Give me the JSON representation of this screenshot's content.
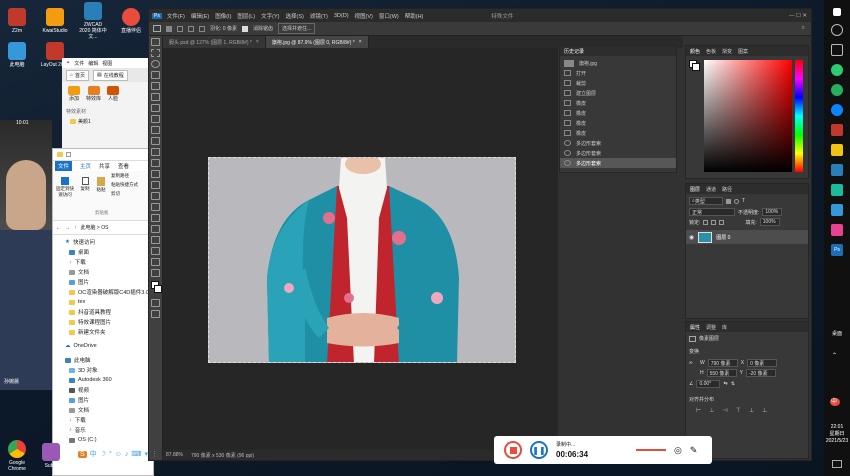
{
  "desktop": {
    "icons_row1": [
      "Z2m",
      "KwaiStudio",
      "ZWCAD 2020 简体中文...",
      "直播伴侣",
      "Effe"
    ],
    "icons_row2": [
      "此电脑",
      "LayOut 2017"
    ],
    "bottom_icons": [
      "Google Chrome",
      "Subst"
    ],
    "chat_label": "孙婉晨"
  },
  "side_app": {
    "title": "特效素材",
    "btn_home": "首页",
    "btn_online": "在线教程",
    "menu": [
      "文件",
      "编辑",
      "视图"
    ],
    "tools": [
      "添加",
      "特效库",
      "人脸"
    ],
    "tree_label": "美颜1",
    "time": "10:01"
  },
  "ps": {
    "menu": [
      "文件(F)",
      "编辑(E)",
      "图像(I)",
      "图层(L)",
      "文字(Y)",
      "选择(S)",
      "滤镜(T)",
      "3D(D)",
      "视图(V)",
      "窗口(W)",
      "帮助(H)"
    ],
    "window_title": "特殊文件",
    "options": {
      "feather_label": "羽化: 0 像素",
      "antialias": "消除锯齿",
      "select_mask": "选择并遮住..."
    },
    "tabs": [
      {
        "label": "服头.psd @ 127% (图层 1, RGB/8#) *"
      },
      {
        "label": "旗袍.jpg @ 87.9% (图层 0, RGB/8#) *"
      }
    ],
    "status": {
      "zoom": "87.88%",
      "dims": "790 像素 x 530 像素 (96 ppi)"
    },
    "history": {
      "title": "历史记录",
      "doc": "旗袍.jpg",
      "items": [
        "打开",
        "裁剪",
        "建立图层",
        "橡皮",
        "橡皮",
        "橡皮",
        "橡皮",
        "多边形套索",
        "多边形套索",
        "多边形套索"
      ],
      "selected_index": 9
    },
    "color_panel": {
      "tabs": [
        "颜色",
        "色板",
        "渐变",
        "图案"
      ]
    },
    "layers_panel": {
      "tabs": [
        "图层",
        "通道",
        "路径"
      ],
      "kind": "类型",
      "blend": "正常",
      "opacity_label": "不透明度:",
      "opacity": "100%",
      "lock_label": "锁定:",
      "fill_label": "填充:",
      "fill": "100%",
      "layer_name": "图层 0"
    },
    "properties": {
      "tabs": [
        "属性",
        "调整",
        "库"
      ],
      "kind": "像素图层",
      "transform": "变换",
      "w": "790 像素",
      "h": "550 像素",
      "x": "0 像素",
      "y": "-20 像素",
      "angle": "0.00°",
      "align": "对齐并分布"
    }
  },
  "explorer": {
    "ribbon_tabs": [
      "文件",
      "主页",
      "共享",
      "查看"
    ],
    "ribbon_btns": [
      "固定到快速访问",
      "复制",
      "粘贴",
      "复制路径",
      "粘贴快捷方式",
      "剪切",
      "剪贴板"
    ],
    "path": "此电脑 > OS",
    "items": [
      "快速访问",
      "桌面",
      "下载",
      "文档",
      "图片",
      "OC渲染器破解版C4D插件3.0",
      "tex",
      "抖音道具教程",
      "特效课程图片",
      "新建文件夹",
      "OneDrive",
      "此电脑",
      "3D 对象",
      "Autodesk 360",
      "视频",
      "图片",
      "文档",
      "下载",
      "音乐",
      "OS (C:)"
    ]
  },
  "taskbar": {
    "lang": "中",
    "time": "22:01",
    "weekday": "星期日",
    "date": "2021/5/23",
    "desktop_label": "桌面"
  },
  "recorder": {
    "status": "录制中...",
    "time": "00:06:34"
  }
}
